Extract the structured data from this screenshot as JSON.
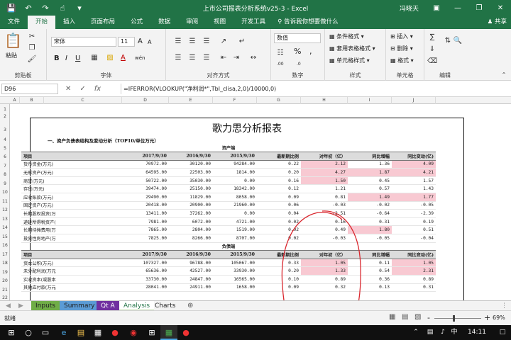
{
  "titlebar": {
    "title": "上市公司报表分析系统v25-3  -  Excel",
    "user": "冯晓天",
    "icons": [
      "save-icon",
      "undo-icon",
      "redo-icon",
      "touch-mode-icon",
      "dropdown-icon"
    ]
  },
  "tabs": [
    "文件",
    "开始",
    "插入",
    "页面布局",
    "公式",
    "数据",
    "审阅",
    "视图",
    "开发工具"
  ],
  "active_tab": "开始",
  "tellme": "告诉我你想要做什么",
  "share": "共享",
  "ribbon": {
    "clipboard": {
      "label": "剪贴板",
      "paste": "粘贴"
    },
    "font": {
      "label": "字体",
      "name": "宋体",
      "size": "11",
      "bold": "B",
      "italic": "I",
      "underline": "U",
      "grow": "A",
      "shrink": "A",
      "color_a": "A",
      "wen": "wén"
    },
    "alignment": {
      "label": "对齐方式"
    },
    "number": {
      "label": "数字",
      "format": "数值",
      "pct": "%",
      "comma": ",",
      "inc": ".00",
      "dec": ".0"
    },
    "styles": {
      "label": "样式",
      "cond": "条件格式",
      "table": "套用表格格式",
      "cell": "单元格样式"
    },
    "cells": {
      "label": "单元格",
      "insert": "插入",
      "delete": "删除",
      "format": "格式"
    },
    "editing": {
      "label": "编辑"
    }
  },
  "formula_bar": {
    "namebox": "D96",
    "formula": "=IFERROR(VLOOKUP(\"净利润*\",Tbl_clisa,2,0)/10000,0)"
  },
  "columns": [
    "A",
    "B",
    "C",
    "D",
    "E",
    "F",
    "G",
    "H",
    "I",
    "J"
  ],
  "rows": [
    "1",
    "2",
    "3",
    "4",
    "5",
    "6",
    "7",
    "8",
    "9",
    "10",
    "11",
    "12",
    "13",
    "14",
    "15",
    "16",
    "17",
    "18",
    "19",
    "20",
    "21",
    "22"
  ],
  "report": {
    "title": "歌力思分析报表",
    "section": "一、资产负债表结构及变动分析（TOP10/单位万元）",
    "asset_label": "资产端",
    "liab_label": "负债端",
    "headers": [
      "项目",
      "2017/9/30",
      "2016/9/30",
      "2015/9/30",
      "最新期比例",
      "对年初（亿）",
      "同比增幅",
      "同比变动(亿)"
    ],
    "asset_rows": [
      {
        "name": "货币资金(万元)",
        "v": [
          "70972.00",
          "30120.00",
          "94284.00",
          "0.22",
          "2.12",
          "1.36",
          "4.09"
        ],
        "hl": [
          5,
          7
        ]
      },
      {
        "name": "无形资产(万元)",
        "v": [
          "64595.00",
          "22503.00",
          "1814.00",
          "0.20",
          "4.27",
          "1.87",
          "4.21"
        ],
        "hl": [
          5,
          6,
          7
        ]
      },
      {
        "name": "商誉(万元)",
        "v": [
          "50722.00",
          "35030.00",
          "0.00",
          "0.16",
          "1.50",
          "0.45",
          "1.57"
        ],
        "hl": [
          5
        ]
      },
      {
        "name": "存货(万元)",
        "v": [
          "39474.00",
          "25150.00",
          "18342.00",
          "0.12",
          "1.21",
          "0.57",
          "1.43"
        ],
        "hl": []
      },
      {
        "name": "应收账款(万元)",
        "v": [
          "29490.00",
          "11829.00",
          "8058.00",
          "0.09",
          "0.81",
          "1.49",
          "1.77"
        ],
        "hl": [
          6,
          7
        ]
      },
      {
        "name": "固定资产(万元)",
        "v": [
          "20418.00",
          "20900.00",
          "21960.00",
          "0.06",
          "-0.03",
          "-0.02",
          "-0.05"
        ],
        "hl": []
      },
      {
        "name": "长期股权投资(万",
        "v": [
          "13411.00",
          "37262.00",
          "0.00",
          "0.04",
          "-2.51",
          "-0.64",
          "-2.39"
        ],
        "hl": []
      },
      {
        "name": "递延所得税资产(",
        "v": [
          "7981.00",
          "6072.00",
          "4721.00",
          "0.02",
          "0.16",
          "0.31",
          "0.19"
        ],
        "hl": []
      },
      {
        "name": "长期待摊费用(万",
        "v": [
          "7865.00",
          "2804.00",
          "1519.00",
          "0.02",
          "0.49",
          "1.80",
          "0.51"
        ],
        "hl": [
          6
        ]
      },
      {
        "name": "投资性房地产(万",
        "v": [
          "7825.00",
          "8266.00",
          "8707.00",
          "0.02",
          "-0.03",
          "-0.05",
          "-0.04"
        ],
        "hl": []
      }
    ],
    "liab_rows": [
      {
        "name": "资本公积(万元)",
        "v": [
          "107327.00",
          "96788.00",
          "105067.00",
          "0.33",
          "1.05",
          "0.11",
          "1.05"
        ],
        "hl": [
          5,
          7
        ]
      },
      {
        "name": "未分配利润(万元",
        "v": [
          "65636.00",
          "42527.00",
          "33930.00",
          "0.20",
          "1.33",
          "0.54",
          "2.31"
        ],
        "hl": [
          5,
          7
        ]
      },
      {
        "name": "实收资本(或股本",
        "v": [
          "33730.00",
          "24847.00",
          "16565.00",
          "0.10",
          "0.89",
          "0.36",
          "0.89"
        ],
        "hl": []
      },
      {
        "name": "其他应付款(万元",
        "v": [
          "28041.00",
          "24911.00",
          "1658.00",
          "0.09",
          "0.32",
          "0.13",
          "0.31"
        ],
        "hl": []
      }
    ]
  },
  "sheet_tabs": [
    {
      "label": "Inputs",
      "color": "#70ad47"
    },
    {
      "label": "Summary",
      "color": "#5b9bd5"
    },
    {
      "label": "Qt A",
      "color": "#7030a0"
    },
    {
      "label": "Analysis",
      "color": "#c6e0b4"
    },
    {
      "label": "Charts",
      "color": ""
    }
  ],
  "status": {
    "ready": "就绪",
    "zoom": "69%",
    "minus": "-",
    "plus": "+"
  },
  "taskbar": {
    "time": "14:11",
    "ime": "中"
  },
  "colors": {
    "excel_green": "#217346",
    "highlight": "#f8c9d2",
    "annotation_red": "#d9272e"
  }
}
